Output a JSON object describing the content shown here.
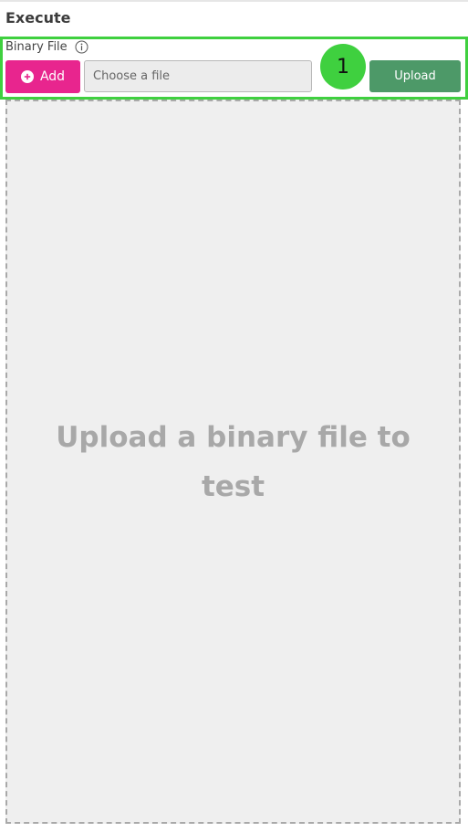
{
  "section": {
    "title": "Execute"
  },
  "binary_file": {
    "label": "Binary File",
    "info_icon": "info-circle-icon",
    "add_button_label": "Add",
    "add_icon": "plus-circle-icon",
    "file_input_placeholder": "Choose a file",
    "upload_button_label": "Upload"
  },
  "step_badge": {
    "number": "1"
  },
  "dropzone": {
    "message": "Upload a binary file to test"
  },
  "colors": {
    "highlight": "#3fd03f",
    "add_button": "#e8258e",
    "upload_button": "#4d9968"
  }
}
